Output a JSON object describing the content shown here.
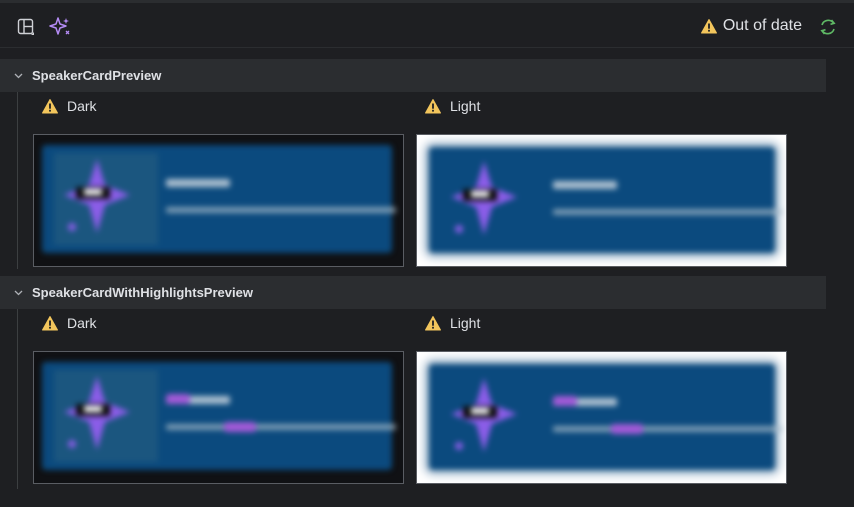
{
  "toolbar": {
    "layout_icon": "layout-panel-icon",
    "magic_icon": "sparkles-icon",
    "status_text": "Out of date",
    "status_icon": "warning-icon",
    "refresh_icon": "refresh-icon"
  },
  "colors": {
    "warning": "#f2c55c",
    "accent": "#a35ad8",
    "refresh": "#5fb865",
    "card": "#0b4a7e"
  },
  "groups": [
    {
      "title": "SpeakerCardPreview",
      "variants": [
        {
          "label": "Dark",
          "theme": "dark"
        },
        {
          "label": "Light",
          "theme": "light"
        }
      ]
    },
    {
      "title": "SpeakerCardWithHighlightsPreview",
      "variants": [
        {
          "label": "Dark",
          "theme": "dark"
        },
        {
          "label": "Light",
          "theme": "light"
        }
      ]
    }
  ]
}
